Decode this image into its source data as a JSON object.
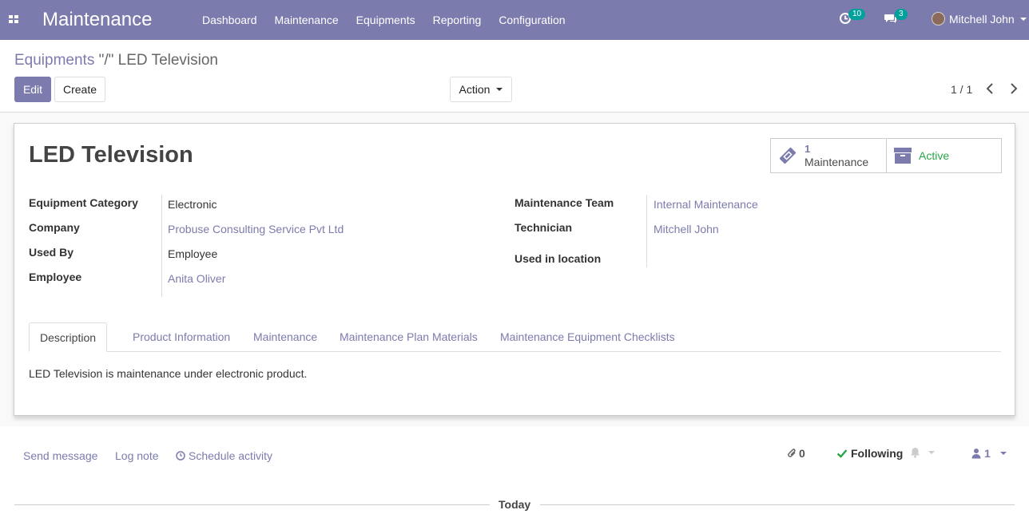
{
  "navbar": {
    "app_title": "Maintenance",
    "menu": [
      "Dashboard",
      "Maintenance",
      "Equipments",
      "Reporting",
      "Configuration"
    ],
    "activity_count": "10",
    "message_count": "3",
    "user_name": "Mitchell John",
    "bg_color": "#7c7bad"
  },
  "breadcrumb": {
    "parent": "Equipments",
    "separator": " \"/\" ",
    "current": "LED Television"
  },
  "toolbar": {
    "edit_label": "Edit",
    "create_label": "Create",
    "action_label": "Action",
    "pager": "1 / 1"
  },
  "record": {
    "title": "LED Television",
    "smart_buttons": {
      "maintenance_count": "1",
      "maintenance_label": "Maintenance",
      "active_label": "Active"
    },
    "left_fields": [
      {
        "label": "Equipment Category",
        "value": "Electronic"
      },
      {
        "label": "Company",
        "value": "Probuse Consulting Service Pvt Ltd"
      },
      {
        "label": "Used By",
        "value": "Employee"
      },
      {
        "label": "Employee",
        "value": "Anita Oliver"
      }
    ],
    "right_fields": [
      {
        "label": "Maintenance Team",
        "value": "Internal Maintenance"
      },
      {
        "label": "Technician",
        "value": "Mitchell John"
      },
      {
        "label": "Used in location",
        "value": ""
      }
    ],
    "tabs": [
      "Description",
      "Product Information",
      "Maintenance",
      "Maintenance Plan Materials",
      "Maintenance Equipment Checklists"
    ],
    "description": "LED Television is maintenance under electronic product."
  },
  "chatter": {
    "send_message": "Send message",
    "log_note": "Log note",
    "schedule_activity": "Schedule activity",
    "attachments_count": "0",
    "following_label": "Following",
    "followers_count": "1",
    "today_label": "Today"
  }
}
